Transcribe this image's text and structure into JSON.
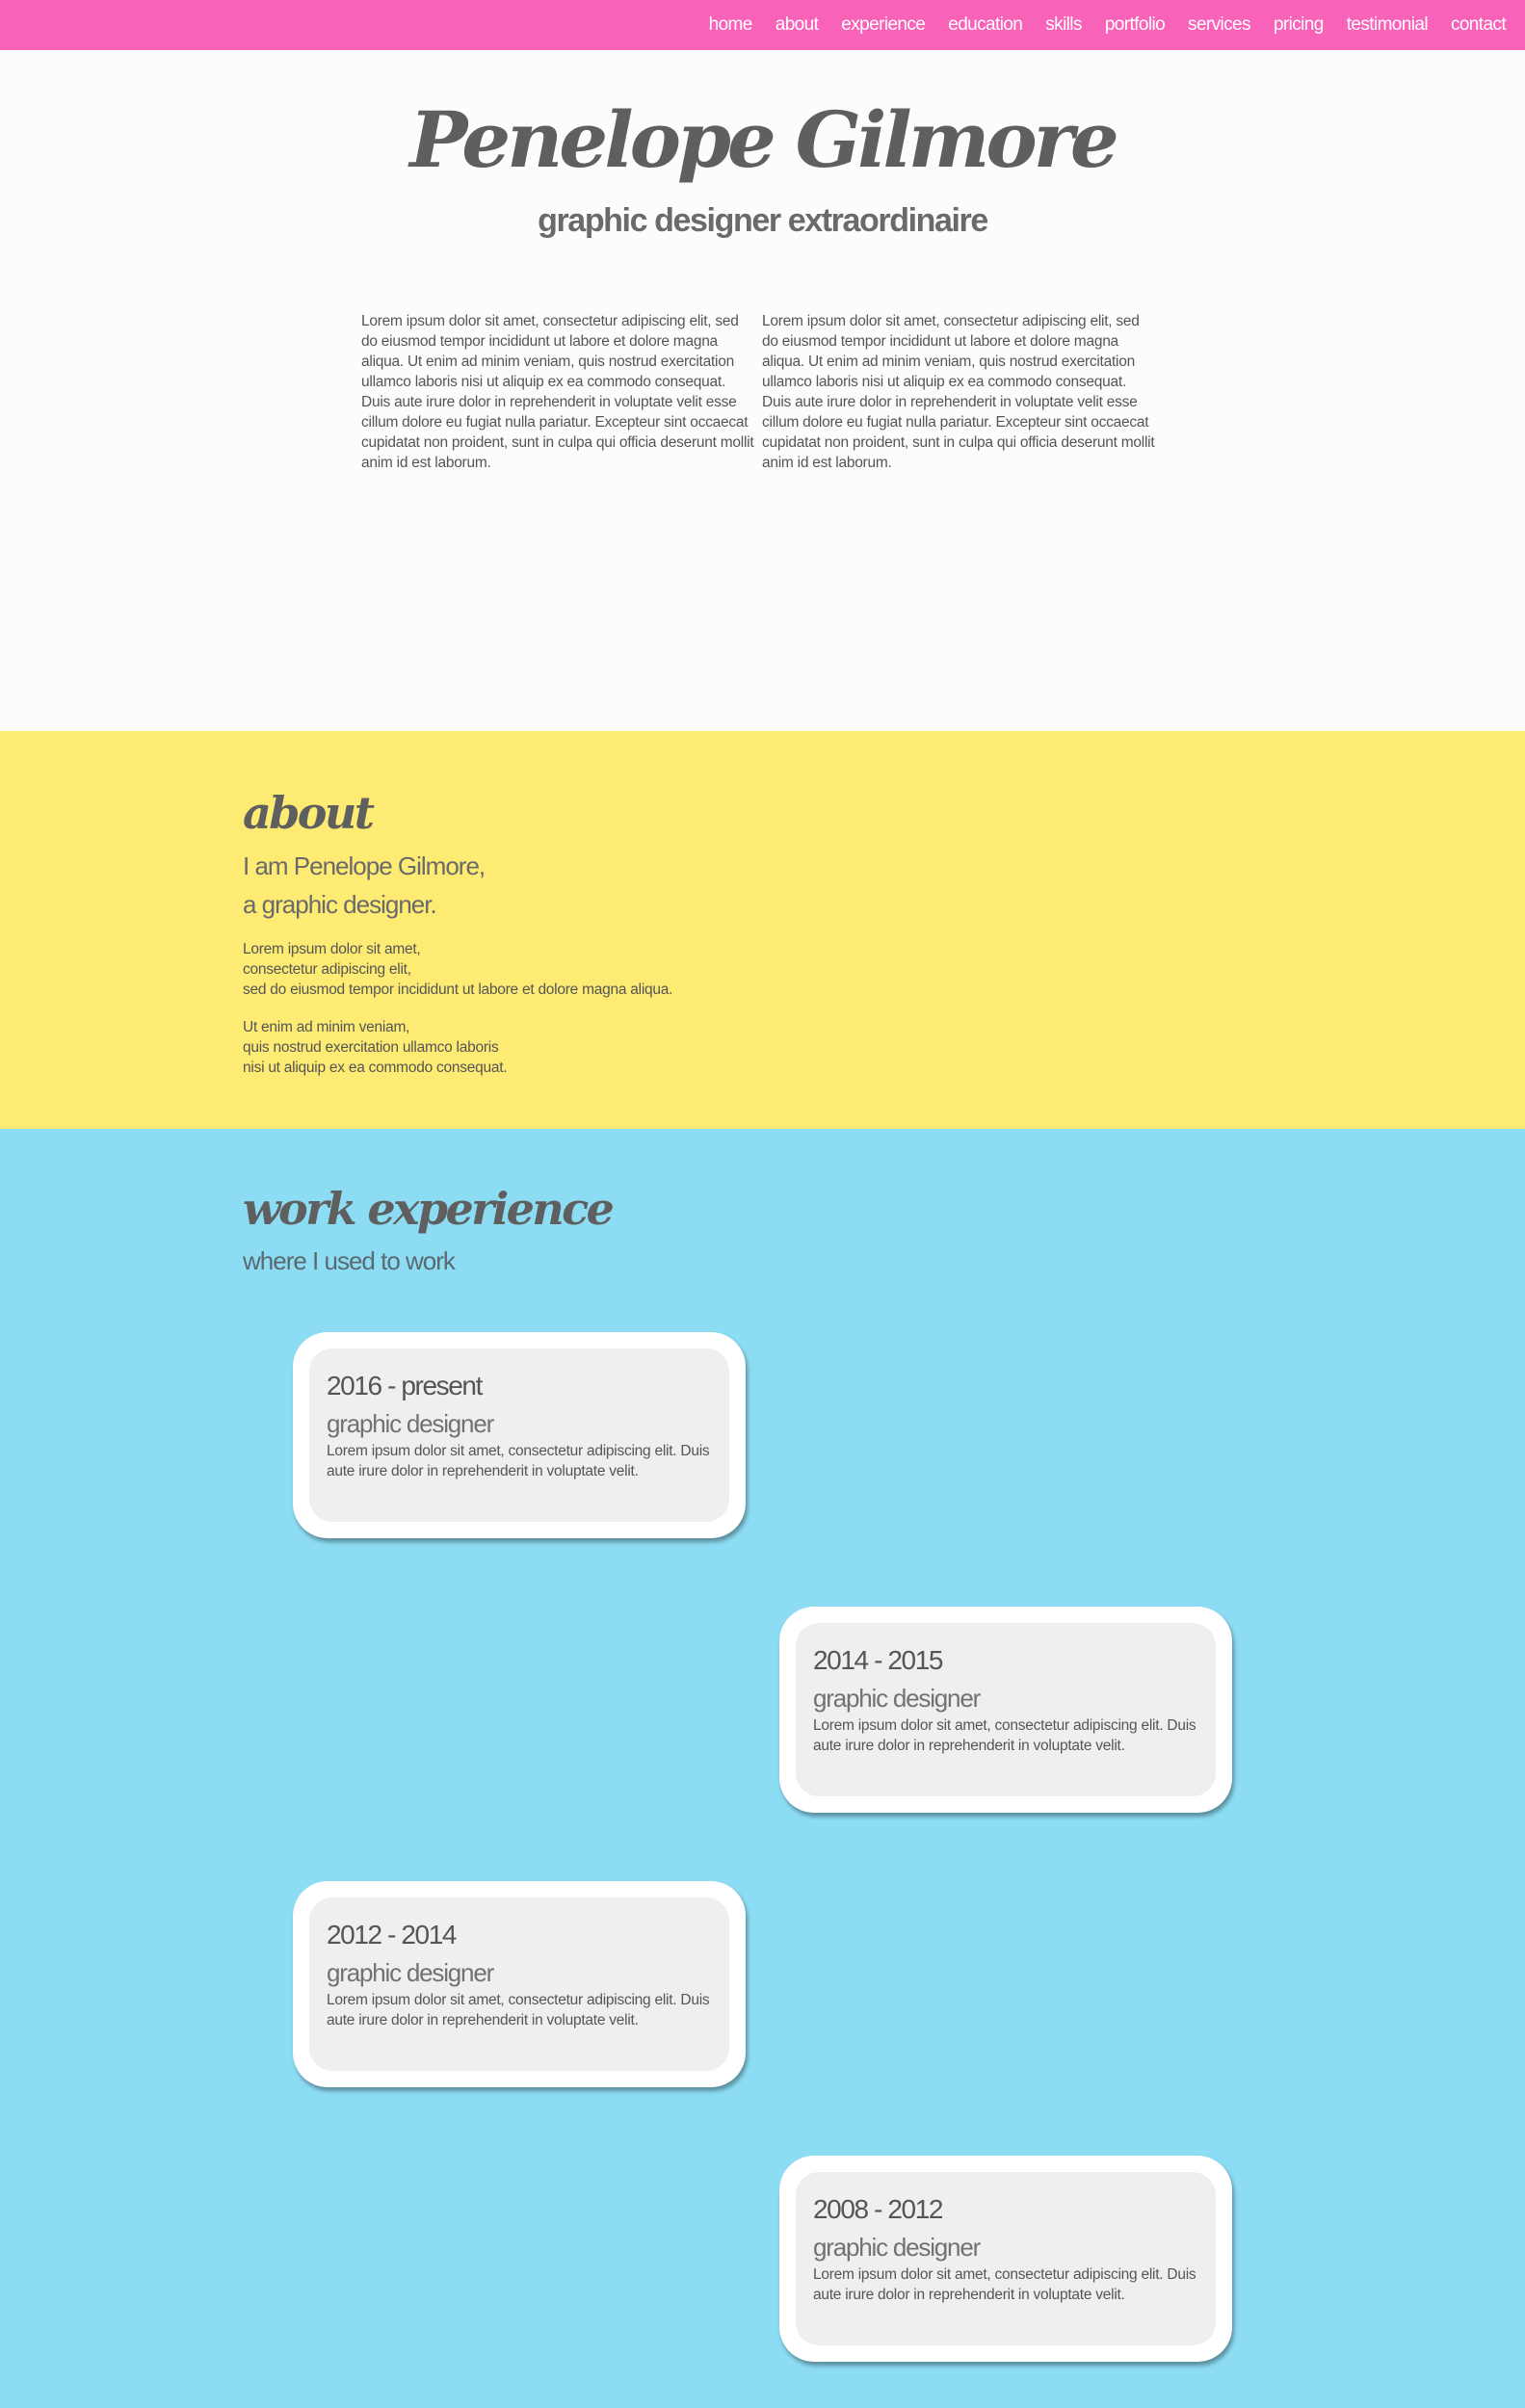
{
  "nav": {
    "items": [
      "home",
      "about",
      "experience",
      "education",
      "skills",
      "portfolio",
      "services",
      "pricing",
      "testimonial",
      "contact"
    ]
  },
  "hero": {
    "name": "Penelope Gilmore",
    "tagline": "graphic designer extraordinaire",
    "columns": [
      "Lorem ipsum dolor sit amet, consectetur adipiscing elit, sed do eiusmod tempor incididunt ut labore et dolore magna aliqua. Ut enim ad minim veniam, quis nostrud exercitation ullamco laboris nisi ut aliquip ex ea commodo consequat. Duis aute irure dolor in reprehenderit in voluptate velit esse cillum dolore eu fugiat nulla pariatur. Excepteur sint occaecat cupidatat non proident, sunt in culpa qui officia deserunt mollit anim id est laborum.",
      "Lorem ipsum dolor sit amet, consectetur adipiscing elit, sed do eiusmod tempor incididunt ut labore et dolore magna aliqua. Ut enim ad minim veniam, quis nostrud exercitation ullamco laboris nisi ut aliquip ex ea commodo consequat. Duis aute irure dolor in reprehenderit in voluptate velit esse cillum dolore eu fugiat nulla pariatur. Excepteur sint occaecat cupidatat non proident, sunt in culpa qui officia deserunt mollit anim id est laborum."
    ]
  },
  "about": {
    "heading": "about",
    "intro_line_1": "I am Penelope Gilmore,",
    "intro_line_2": "a graphic designer.",
    "para1": [
      "Lorem ipsum dolor sit amet,",
      "consectetur adipiscing elit,",
      "sed do eiusmod tempor incididunt ut labore et dolore magna aliqua."
    ],
    "para2": [
      "Ut enim ad minim veniam,",
      "quis nostrud exercitation ullamco laboris",
      "nisi ut aliquip ex ea commodo consequat."
    ]
  },
  "experience": {
    "heading": "work experience",
    "subtitle": "where I used to work",
    "jobs": [
      {
        "years": "2016 - present",
        "role": "graphic designer",
        "desc": "Lorem ipsum dolor sit amet, consectetur adipiscing elit. Duis aute irure dolor in reprehenderit in voluptate velit."
      },
      {
        "years": "2014 - 2015",
        "role": "graphic designer",
        "desc": "Lorem ipsum dolor sit amet, consectetur adipiscing elit. Duis aute irure dolor in reprehenderit in voluptate velit."
      },
      {
        "years": "2012 - 2014",
        "role": "graphic designer",
        "desc": "Lorem ipsum dolor sit amet, consectetur adipiscing elit. Duis aute irure dolor in reprehenderit in voluptate velit."
      },
      {
        "years": "2008 - 2012",
        "role": "graphic designer",
        "desc": "Lorem ipsum dolor sit amet, consectetur adipiscing elit. Duis aute irure dolor in reprehenderit in voluptate velit."
      }
    ]
  },
  "colors": {
    "nav": "#f862b8",
    "hero_bg": "#fcfcfc",
    "about_bg": "#fdeb73",
    "experience_bg": "#8cdcf3",
    "card_outer": "#ffffff",
    "card_inner": "#efefef",
    "text": "#5a5a5a"
  }
}
